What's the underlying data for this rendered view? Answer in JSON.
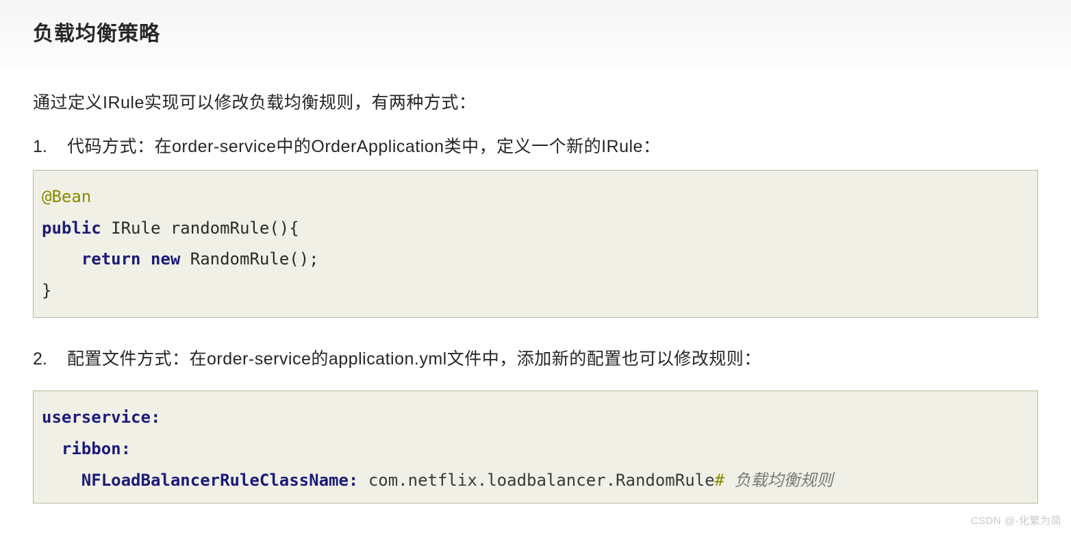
{
  "header": {
    "title": "负载均衡策略"
  },
  "intro": "通过定义IRule实现可以修改负载均衡规则，有两种方式：",
  "items": [
    {
      "num": "1.",
      "text": "代码方式：在order-service中的OrderApplication类中，定义一个新的IRule："
    },
    {
      "num": "2.",
      "text": "配置文件方式：在order-service的application.yml文件中，添加新的配置也可以修改规则："
    }
  ],
  "code1": {
    "annotation": "@Bean",
    "kw_public": "public",
    "sig_rest": " IRule randomRule(){",
    "kw_return": "return",
    "kw_new": "new",
    "ctor": " RandomRule();",
    "close": "}"
  },
  "code2": {
    "k1": "userservice:",
    "k2": "ribbon:",
    "k3": "NFLoadBalancerRuleClassName:",
    "val": " com.netflix.loadbalancer.RandomRule",
    "hash": "#",
    "comment": " 负载均衡规则"
  },
  "watermark": "CSDN @-化繁为简"
}
